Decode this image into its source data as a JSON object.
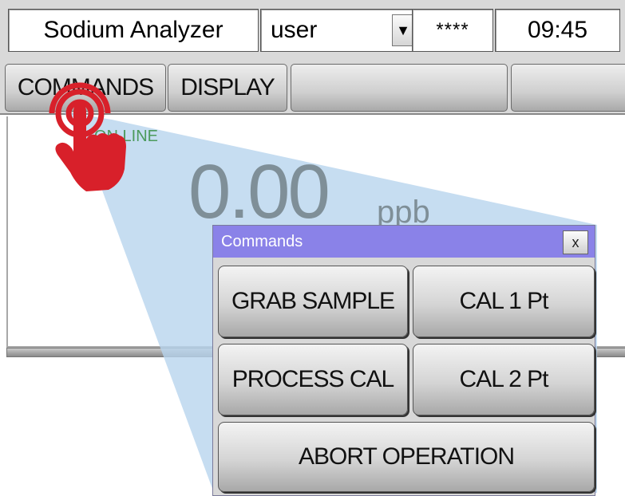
{
  "header": {
    "app_title": "Sodium Analyzer",
    "user": "user",
    "password_mask": "****",
    "time": "09:45"
  },
  "tabs": {
    "commands": "COMMANDS",
    "display": "DISPLAY",
    "empty1": "",
    "empty2": ""
  },
  "display": {
    "status": "ON LINE",
    "reading": "0.00",
    "units": "ppb"
  },
  "dialog": {
    "title": "Commands",
    "close": "x",
    "buttons": {
      "grab_sample": "GRAB SAMPLE",
      "cal_1pt": "CAL 1 Pt",
      "process_cal": "PROCESS CAL",
      "cal_2pt": "CAL 2 Pt",
      "abort": "ABORT OPERATION"
    }
  },
  "colors": {
    "dialog_title_bar": "#8a82e8",
    "status_text": "#4c9a5c",
    "reading_text": "#7f8f98",
    "callout": "#b8d4ee",
    "hand": "#d8202a"
  },
  "icons": {
    "user_dropdown": "dropdown-arrow-icon",
    "cursor": "tap-hand-icon"
  }
}
